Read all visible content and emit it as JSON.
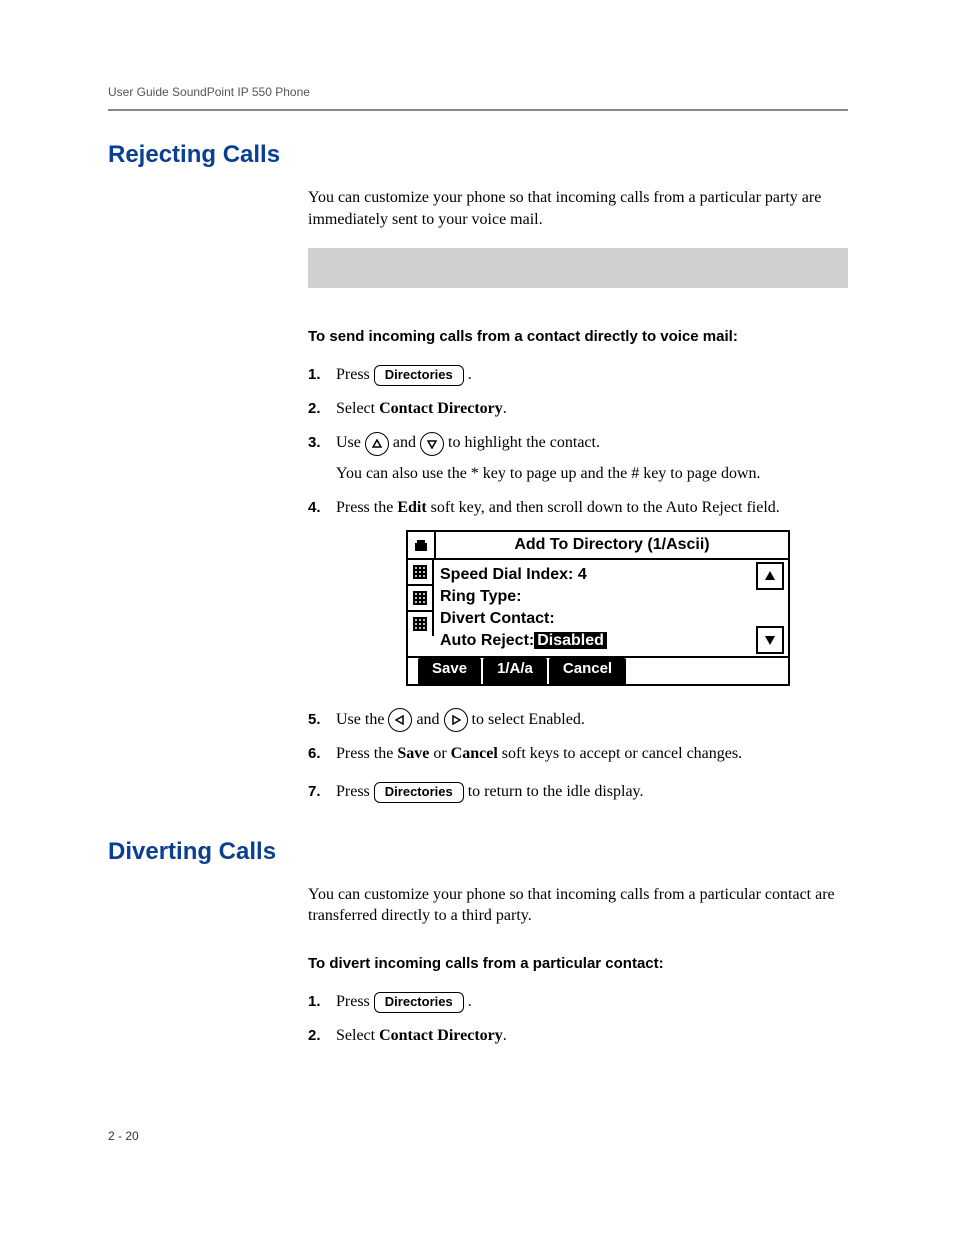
{
  "header": {
    "running": "User Guide SoundPoint IP 550 Phone"
  },
  "section1": {
    "title": "Rejecting Calls",
    "intro": "You can customize your phone so that incoming calls from a particular party are immediately sent to your voice mail.",
    "procTitle": "To send incoming calls from a contact directly to voice mail:",
    "steps": {
      "s1_a": "Press ",
      "s1_key": "Directories",
      "s1_b": " .",
      "s2_a": "Select ",
      "s2_b": "Contact Directory",
      "s2_c": ".",
      "s3_a": "Use ",
      "s3_b": " and ",
      "s3_c": " to highlight the contact.",
      "s3_note": "You can also use the * key to page up and the # key to page down.",
      "s4_a": "Press the ",
      "s4_b": "Edit",
      "s4_c": " soft key, and then scroll down to the Auto Reject field.",
      "s5_a": "Use the ",
      "s5_b": "  and ",
      "s5_c": "  to select Enabled.",
      "s6_a": "Press the ",
      "s6_b": "Save",
      "s6_c": " or ",
      "s6_d": "Cancel",
      "s6_e": " soft keys to accept or cancel changes.",
      "s7_a": "Press ",
      "s7_key": "Directories",
      "s7_b": " to return to the idle display."
    }
  },
  "lcd": {
    "title": "Add To Directory (1/Ascii)",
    "line1": "Speed Dial Index: 4",
    "line2": "Ring Type:",
    "line3": "Divert Contact:",
    "line4a": "Auto Reject:",
    "line4b": "Disabled",
    "sk1": "Save",
    "sk2": "1/A/a",
    "sk3": "Cancel"
  },
  "section2": {
    "title": "Diverting Calls",
    "intro": "You can customize your phone so that incoming calls from a particular contact are transferred directly to a third party.",
    "procTitle": "To divert incoming calls from a particular contact:",
    "steps": {
      "s1_a": "Press ",
      "s1_key": "Directories",
      "s1_b": " .",
      "s2_a": "Select ",
      "s2_b": "Contact Directory",
      "s2_c": "."
    }
  },
  "footer": {
    "pagenum": "2 - 20"
  }
}
